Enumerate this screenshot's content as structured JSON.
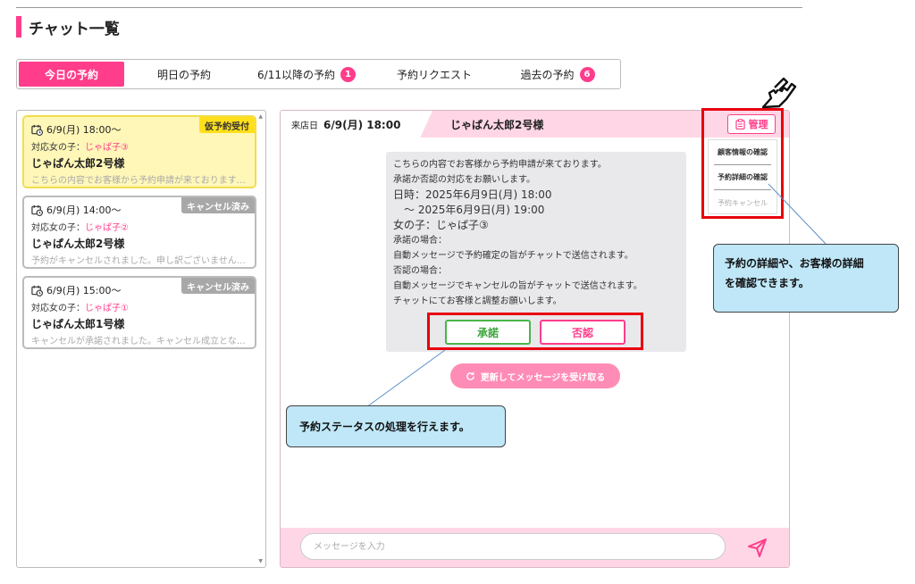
{
  "page": {
    "title": "チャット一覧"
  },
  "tabs": [
    {
      "label": "今日の予約",
      "active": true
    },
    {
      "label": "明日の予約"
    },
    {
      "label": "6/11以降の予約",
      "badge": "1"
    },
    {
      "label": "予約リクエスト"
    },
    {
      "label": "過去の予約",
      "badge": "6"
    }
  ],
  "reservations": [
    {
      "datetime": "6/9(月) 18:00～",
      "girl_label": "対応女の子：",
      "girl_name": "じゃぱ子③",
      "customer": "じゃぱん太郎2号様",
      "preview": "こちらの内容でお客様から予約申請が来ております…",
      "status": "仮予約受付"
    },
    {
      "datetime": "6/9(月) 14:00～",
      "girl_label": "対応女の子：",
      "girl_name": "じゃぱ子②",
      "customer": "じゃぱん太郎2号様",
      "preview": "予約がキャンセルされました。申し訳ございません…",
      "status": "キャンセル済み"
    },
    {
      "datetime": "6/9(月) 15:00～",
      "girl_label": "対応女の子：",
      "girl_name": "じゃぱ子①",
      "customer": "じゃぱん太郎1号様",
      "preview": "キャンセルが承諾されました。キャンセル成立とな…",
      "status": "キャンセル済み"
    }
  ],
  "chat": {
    "header": {
      "visit_label": "来店日",
      "visit_datetime": "6/9(月) 18:00",
      "customer_name": "じゃぱん太郎2号様"
    },
    "message": {
      "line1": "こちらの内容でお客様から予約申請が来ております。",
      "line2": "承諾か否認の対応をお願いします。",
      "line3": "日時：2025年6月9日(月) 18:00",
      "line4": "　～ 2025年6月9日(月) 19:00",
      "line5": "女の子：じゃぱ子③",
      "line6": "承諾の場合：",
      "line7": "自動メッセージで予約確定の旨がチャットで送信されます。",
      "line8": "否認の場合：",
      "line9": "自動メッセージでキャンセルの旨がチャットで送信されます。",
      "line10": "チャットにてお客様と調整お願いします。"
    },
    "approve_label": "承諾",
    "reject_label": "否認",
    "refresh_label": "更新してメッセージを受け取る",
    "input_placeholder": "メッセージを入力"
  },
  "manage": {
    "button_label": "管理",
    "menu": [
      "顧客情報の確認",
      "予約詳細の確認",
      "予約キャンセル"
    ]
  },
  "callouts": {
    "detail_line1": "予約の詳細や、お客様の詳細",
    "detail_line2": "を確認できます。",
    "status": "予約ステータスの処理を行えます。"
  },
  "colors": {
    "accent": "#ff3d8b",
    "header_pink": "#ffd6e6",
    "selected_card": "#fff7b8",
    "status_yellow": "#ffdf1a",
    "status_gray": "#a8a8a8",
    "approve_green": "#4ab54a",
    "callout_blue": "#bfe7f8",
    "highlight_red": "#e8000d"
  }
}
